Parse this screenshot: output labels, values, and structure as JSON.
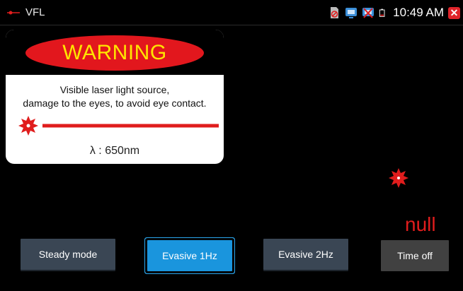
{
  "status_bar": {
    "app_title": "VFL",
    "time": "10:49 AM",
    "icons": [
      "vfl-app-icon",
      "sd-card-icon",
      "network-icon",
      "disconnected-icon",
      "battery-icon",
      "close-icon"
    ]
  },
  "warning": {
    "title": "WARNING",
    "line1": "Visible laser light source,",
    "line2": "damage to the eyes, to avoid eye contact.",
    "wavelength": "λ : 650nm"
  },
  "indicator": {
    "value_text": "null"
  },
  "buttons": {
    "steady": "Steady mode",
    "evasive_1hz": "Evasive 1Hz",
    "evasive_2hz": "Evasive 2Hz",
    "time_off": "Time off",
    "active": "evasive_1hz"
  },
  "colors": {
    "laser_red": "#e01d1d",
    "warning_yellow": "#ffe500",
    "active_blue": "#1a95dd",
    "button_slate": "#3a4654"
  }
}
